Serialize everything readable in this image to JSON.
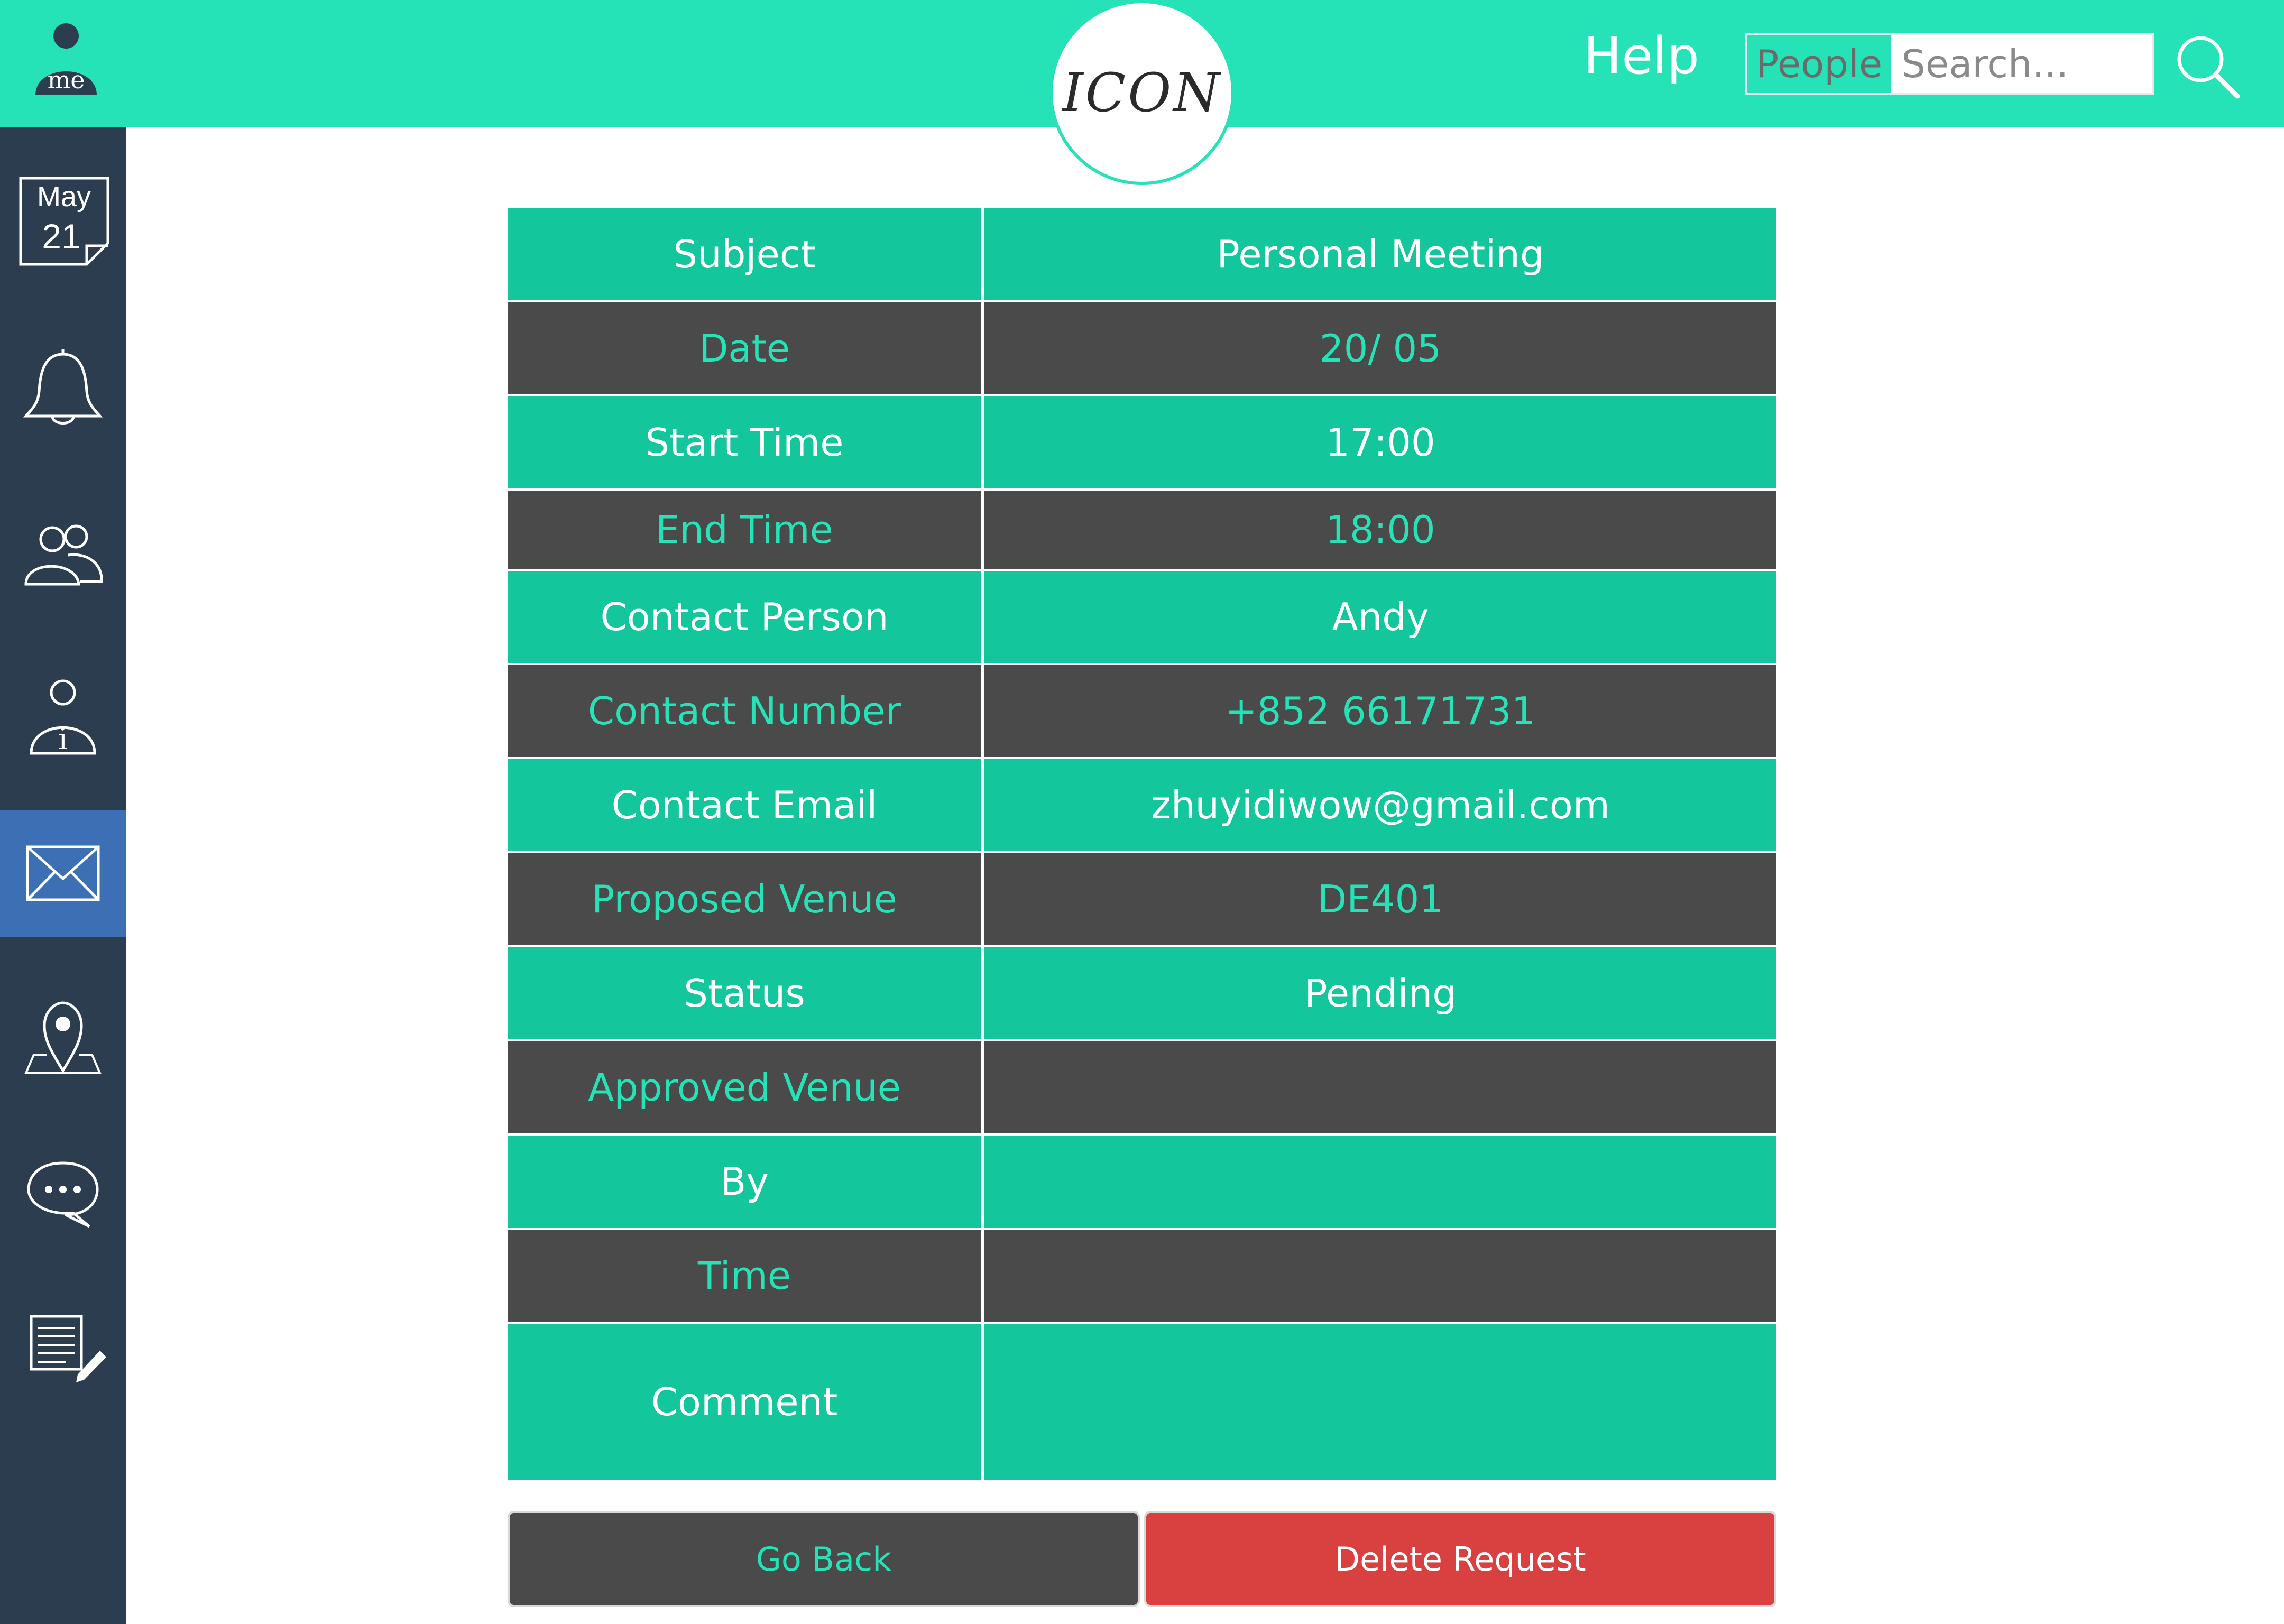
{
  "header": {
    "avatar_label": "me",
    "logo_text": "ICON",
    "help_label": "Help",
    "search_scope": "People",
    "search_placeholder": "Search..."
  },
  "sidebar": {
    "calendar_month": "May",
    "calendar_day": "21",
    "items": [
      {
        "icon": "calendar-icon"
      },
      {
        "icon": "bell-icon"
      },
      {
        "icon": "people-icon"
      },
      {
        "icon": "user-info-icon"
      },
      {
        "icon": "mail-icon",
        "active": true
      },
      {
        "icon": "map-pin-icon"
      },
      {
        "icon": "chat-bubble-icon"
      },
      {
        "icon": "edit-document-icon"
      }
    ]
  },
  "details": {
    "rows": [
      {
        "label": "Subject",
        "value": "Personal Meeting"
      },
      {
        "label": "Date",
        "value": "20/ 05"
      },
      {
        "label": "Start Time",
        "value": "17:00"
      },
      {
        "label": "End Time",
        "value": "18:00"
      },
      {
        "label": "Contact Person",
        "value": "Andy"
      },
      {
        "label": "Contact Number",
        "value": "+852 66171731"
      },
      {
        "label": "Contact Email",
        "value": "zhuyidiwow@gmail.com"
      },
      {
        "label": "Proposed Venue",
        "value": "DE401"
      },
      {
        "label": "Status",
        "value": "Pending"
      },
      {
        "label": "Approved Venue",
        "value": ""
      },
      {
        "label": "By",
        "value": ""
      },
      {
        "label": "Time",
        "value": ""
      },
      {
        "label": "Comment",
        "value": ""
      }
    ]
  },
  "actions": {
    "go_back": "Go Back",
    "delete_request": "Delete Request"
  },
  "colors": {
    "topbar": "#26e2b7",
    "row_green": "#13c69c",
    "row_dark": "#4a4a4a",
    "sidebar": "#2c3d4f",
    "sidebar_active": "#3d6fb5",
    "delete": "#d94141"
  }
}
